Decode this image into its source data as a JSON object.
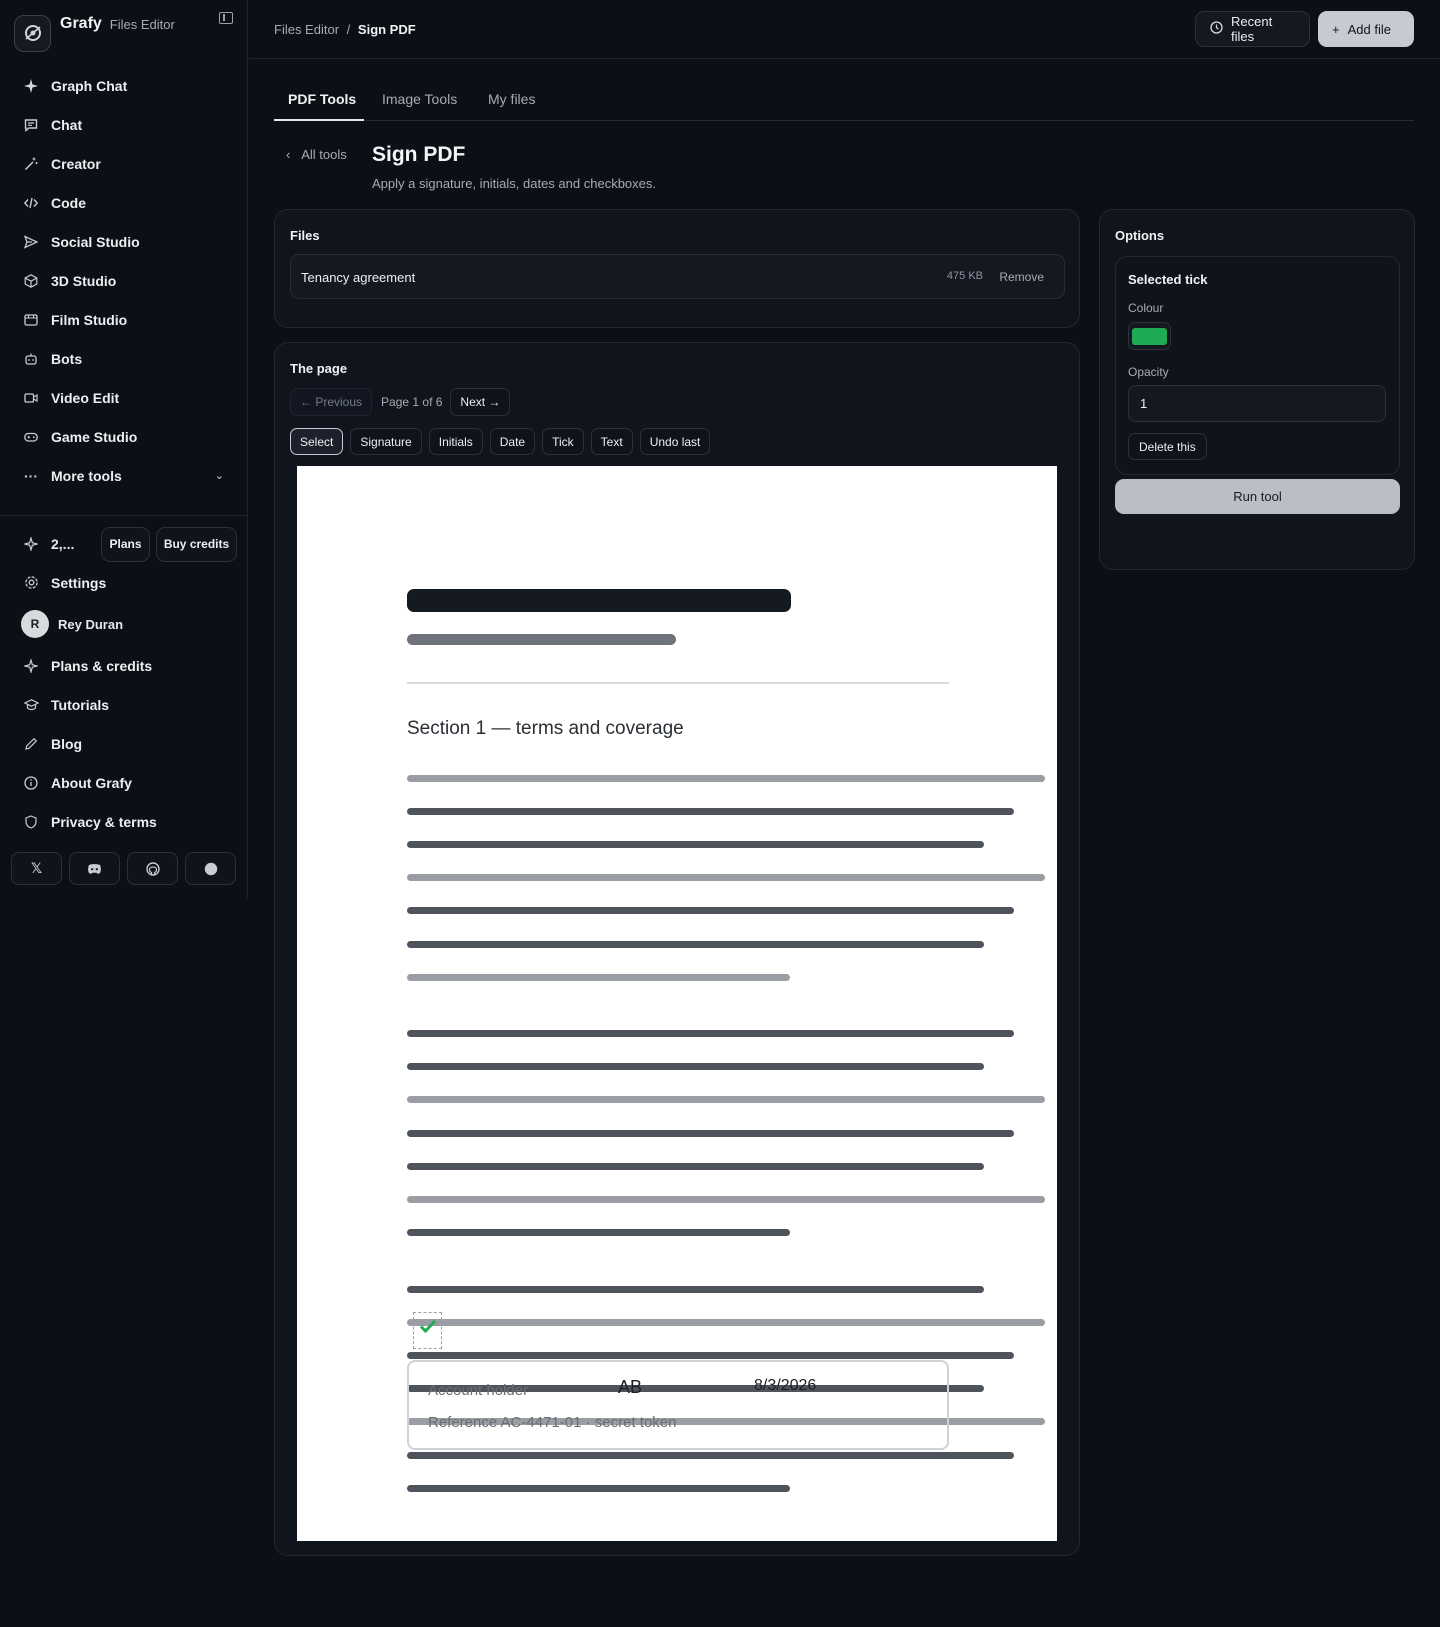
{
  "app": {
    "name": "Grafy",
    "subtitle": "Files Editor"
  },
  "sidebar": {
    "items": [
      {
        "label": "Graph Chat",
        "icon": "sparkle-icon"
      },
      {
        "label": "Chat",
        "icon": "chat-bubble-icon"
      },
      {
        "label": "Creator",
        "icon": "magic-wand-icon"
      },
      {
        "label": "Code",
        "icon": "code-icon"
      },
      {
        "label": "Social Studio",
        "icon": "send-icon"
      },
      {
        "label": "3D Studio",
        "icon": "cube-icon"
      },
      {
        "label": "Film Studio",
        "icon": "film-icon"
      },
      {
        "label": "Bots",
        "icon": "bot-icon"
      },
      {
        "label": "Video Edit",
        "icon": "video-icon"
      },
      {
        "label": "Game Studio",
        "icon": "gamepad-icon"
      },
      {
        "label": "More tools",
        "icon": "ellipsis-icon"
      }
    ],
    "credits": {
      "count": "2,...",
      "plans_label": "Plans",
      "buy_label": "Buy credits"
    },
    "settings_label": "Settings",
    "user": {
      "initial": "R",
      "name": "Rey Duran"
    },
    "links": [
      {
        "label": "Plans & credits",
        "icon": "sparkle-outline-icon"
      },
      {
        "label": "Tutorials",
        "icon": "graduation-cap-icon"
      },
      {
        "label": "Blog",
        "icon": "pencil-icon"
      },
      {
        "label": "About Grafy",
        "icon": "info-icon"
      },
      {
        "label": "Privacy & terms",
        "icon": "shield-icon"
      }
    ],
    "social": [
      "x-icon",
      "discord-icon",
      "github-icon",
      "circle-icon"
    ]
  },
  "header": {
    "breadcrumb_root": "Files Editor",
    "breadcrumb_sep": "/",
    "breadcrumb_current": "Sign PDF",
    "recent_label": "Recent files",
    "add_label": "Add file"
  },
  "tabs": [
    {
      "label": "PDF Tools",
      "active": true
    },
    {
      "label": "Image Tools",
      "active": false
    },
    {
      "label": "My files",
      "active": false
    }
  ],
  "tool": {
    "back_label": "All tools",
    "title": "Sign PDF",
    "subtitle": "Apply a signature, initials, dates and checkboxes."
  },
  "files": {
    "title": "Files",
    "items": [
      {
        "name": "Tenancy agreement",
        "size": "475 KB",
        "remove_label": "Remove"
      }
    ]
  },
  "page_panel": {
    "title": "The page",
    "prev_label": "← Previous",
    "page_label": "Page 1 of 6",
    "next_label": "Next →",
    "tools": [
      "Select",
      "Signature",
      "Initials",
      "Date",
      "Tick",
      "Text",
      "Undo last"
    ],
    "active_tool": "Select"
  },
  "document": {
    "section_heading": "Section 1 — terms and coverage",
    "field_label": "Account holder",
    "initials": "AB",
    "date": "8/3/2026",
    "reference": "Reference AC-4471-01 · secret token",
    "tick_color": "#1faa55"
  },
  "options": {
    "title": "Options",
    "selected_title": "Selected tick",
    "colour_label": "Colour",
    "colour_value": "#1faa55",
    "opacity_label": "Opacity",
    "opacity_value": "1",
    "delete_label": "Delete this",
    "run_label": "Run tool"
  }
}
